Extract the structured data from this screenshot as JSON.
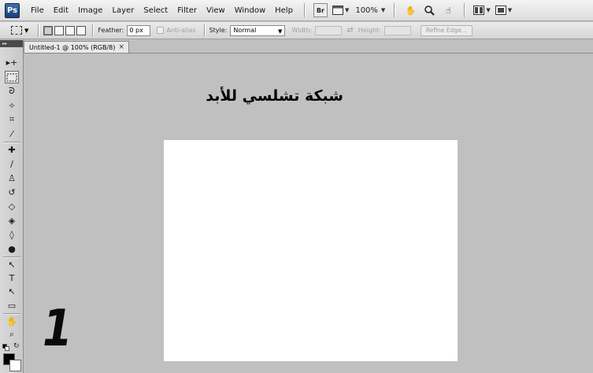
{
  "app": {
    "logo": "Ps"
  },
  "menu": [
    "File",
    "Edit",
    "Image",
    "Layer",
    "Select",
    "Filter",
    "View",
    "Window",
    "Help"
  ],
  "menubar_tools": {
    "bridge_label": "Br",
    "zoom_value": "100%",
    "icons": [
      "bridge-icon",
      "view-extras-icon",
      "hand-tool-icon",
      "zoom-tool-icon",
      "rotate-view-icon",
      "arrange-documents-icon",
      "screen-mode-icon"
    ]
  },
  "options": {
    "feather_label": "Feather:",
    "feather_value": "0 px",
    "antialias_label": "Anti-alias",
    "style_label": "Style:",
    "style_value": "Normal",
    "width_label": "Width:",
    "height_label": "Height:",
    "refine_edge_label": "Refine Edge..."
  },
  "toolbox": {
    "collapse_label": "▸▸",
    "tools": [
      {
        "name": "move-tool-icon",
        "glyph": "▸+"
      },
      {
        "name": "marquee-tool-icon",
        "glyph": "⬚"
      },
      {
        "name": "lasso-tool-icon",
        "glyph": "ᘐ"
      },
      {
        "name": "quick-selection-tool-icon",
        "glyph": "✧"
      },
      {
        "name": "crop-tool-icon",
        "glyph": "⌗"
      },
      {
        "name": "eyedropper-tool-icon",
        "glyph": "⁄"
      },
      {
        "name": "healing-brush-tool-icon",
        "glyph": "✚"
      },
      {
        "name": "brush-tool-icon",
        "glyph": "∕"
      },
      {
        "name": "clone-stamp-tool-icon",
        "glyph": "♙"
      },
      {
        "name": "history-brush-tool-icon",
        "glyph": "↺"
      },
      {
        "name": "eraser-tool-icon",
        "glyph": "◇"
      },
      {
        "name": "paint-bucket-tool-icon",
        "glyph": "◈"
      },
      {
        "name": "blur-tool-icon",
        "glyph": "◊"
      },
      {
        "name": "dodge-tool-icon",
        "glyph": "●"
      },
      {
        "name": "path-selection-tool-icon",
        "glyph": "↖"
      },
      {
        "name": "type-tool-icon",
        "glyph": "T"
      },
      {
        "name": "direct-selection-tool-icon",
        "glyph": "↖"
      },
      {
        "name": "shape-tool-icon",
        "glyph": "▭"
      },
      {
        "name": "hand-tool-icon",
        "glyph": "✋"
      },
      {
        "name": "zoom-tool-icon",
        "glyph": "⌕"
      }
    ],
    "foreground_color": "#000000",
    "background_color": "#ffffff"
  },
  "document": {
    "tab_title": "Untitled-1 @ 100% (RGB/8)",
    "close_label": "×",
    "canvas_color": "#ffffff",
    "workspace_color": "#c0c0c0"
  },
  "overlay": {
    "title": "شبكة تشلسي للأبد",
    "step_number": "1"
  }
}
